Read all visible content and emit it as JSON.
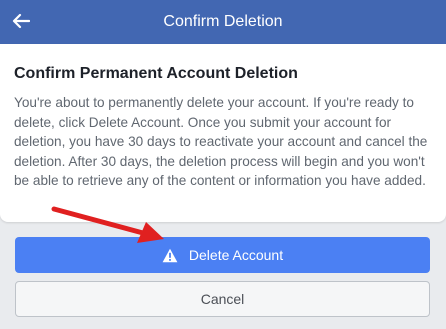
{
  "header": {
    "title": "Confirm Deletion",
    "back_icon": "left-arrow-icon"
  },
  "dialog": {
    "title": "Confirm Permanent Account Deletion",
    "body": "You're about to permanently delete your account. If you're ready to delete, click Delete Account. Once you submit your account for deletion, you have 30 days to reactivate your account and cancel the deletion. After 30 days, the deletion process will begin and you won't be able to retrieve any of the content or information you have added."
  },
  "actions": {
    "delete_label": "Delete Account",
    "delete_icon": "warning-triangle-icon",
    "cancel_label": "Cancel"
  },
  "annotation": {
    "icon": "red-pointer-arrow",
    "color": "#e02020"
  },
  "colors": {
    "header_bg": "#4267b2",
    "primary_button": "#4b80f3",
    "page_bg": "#e9ebee"
  }
}
